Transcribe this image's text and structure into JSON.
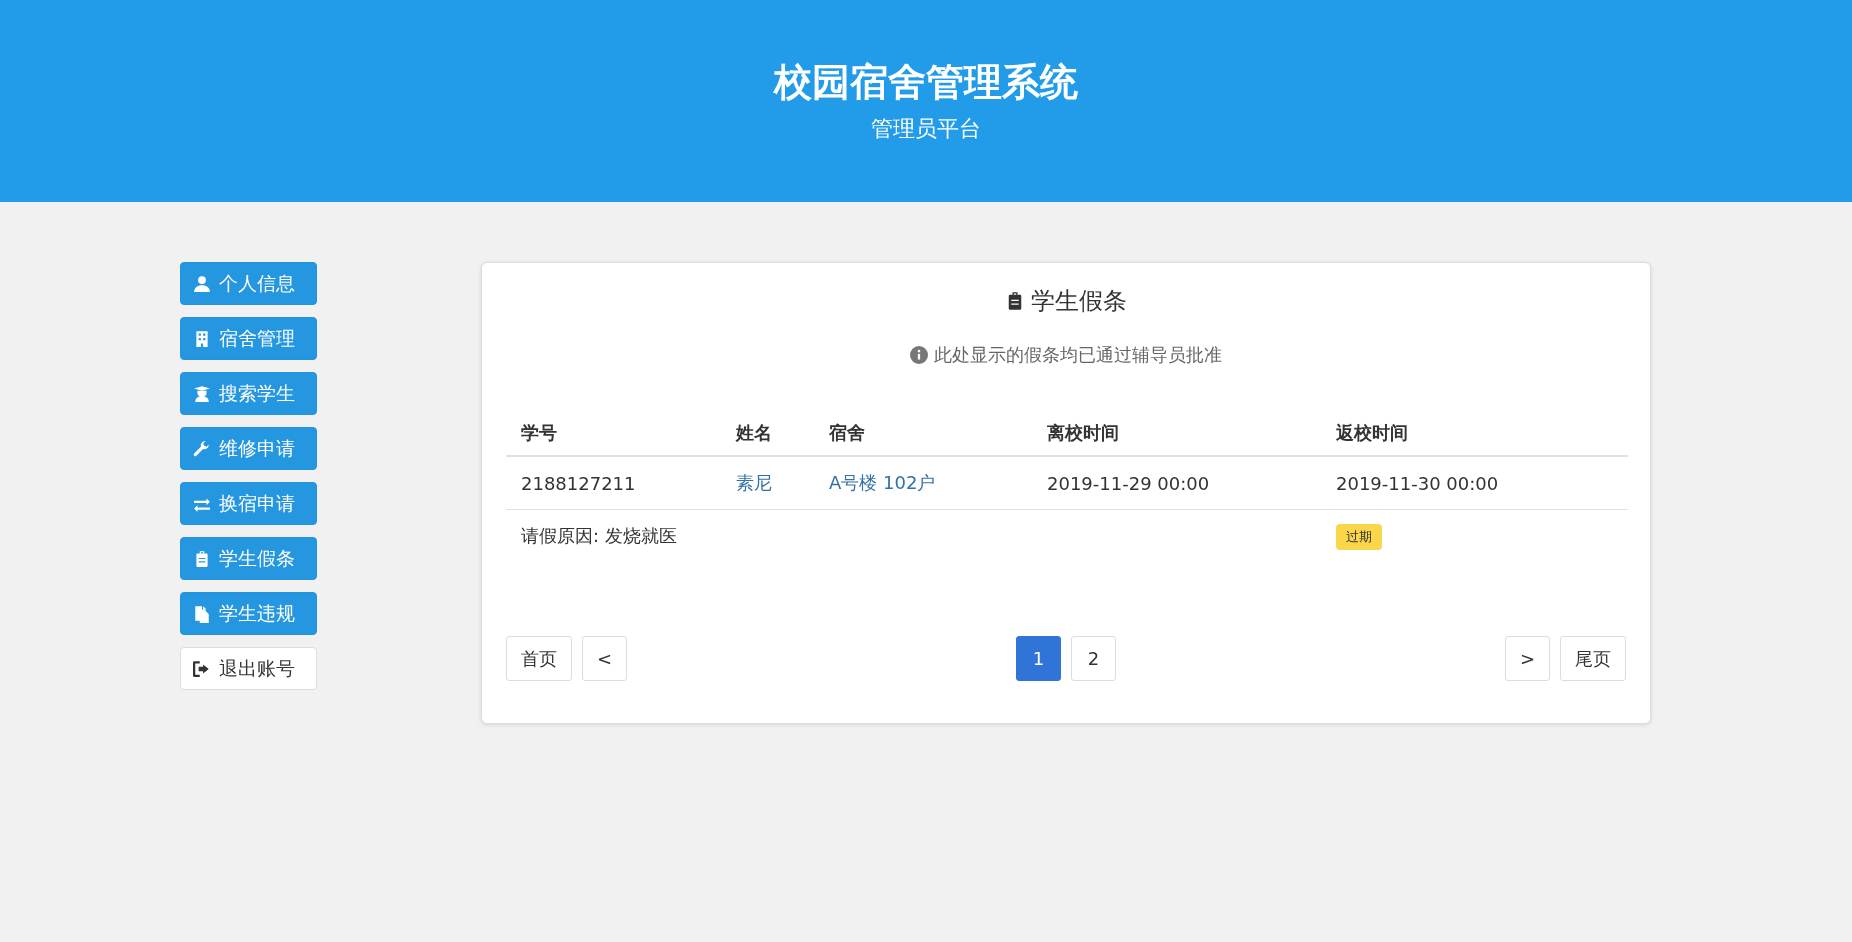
{
  "header": {
    "title": "校园宿舍管理系统",
    "subtitle": "管理员平台"
  },
  "sidebar": {
    "items": [
      {
        "label": "个人信息",
        "kind": "nav"
      },
      {
        "label": "宿舍管理",
        "kind": "nav"
      },
      {
        "label": "搜索学生",
        "kind": "nav"
      },
      {
        "label": "维修申请",
        "kind": "nav"
      },
      {
        "label": "换宿申请",
        "kind": "nav"
      },
      {
        "label": "学生假条",
        "kind": "nav"
      },
      {
        "label": "学生违规",
        "kind": "nav"
      },
      {
        "label": "退出账号",
        "kind": "logout"
      }
    ]
  },
  "card": {
    "title": "学生假条",
    "notice": "此处显示的假条均已通过辅导员批准",
    "table": {
      "columns": [
        "学号",
        "姓名",
        "宿舍",
        "离校时间",
        "返校时间"
      ],
      "rows": [
        {
          "student_id": "2188127211",
          "name": "素尼",
          "dorm": "A号楼 102户",
          "leave_time": "2019-11-29 00:00",
          "return_time": "2019-11-30 00:00",
          "reason": "请假原因: 发烧就医",
          "status": "过期"
        }
      ]
    },
    "pagination": {
      "first": "首页",
      "prev": "<",
      "pages": [
        {
          "label": "1",
          "selected": true
        },
        {
          "label": "2",
          "selected": false
        }
      ],
      "next": ">",
      "last": "尾页"
    }
  }
}
